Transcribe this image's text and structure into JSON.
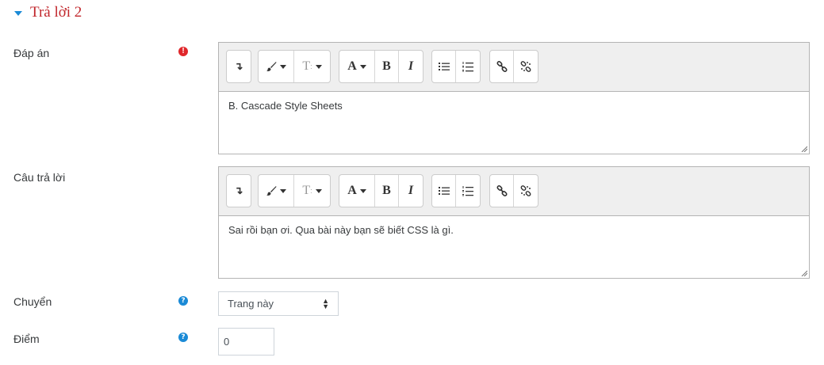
{
  "section": {
    "title": "Trả lời 2"
  },
  "fields": {
    "answer": {
      "label": "Đáp án",
      "value": "B. Cascade Style Sheets"
    },
    "feedback": {
      "label": "Câu trả lời",
      "value": "Sai rồi bạn ơi. Qua bài này bạn sẽ biết CSS là gì."
    },
    "jump": {
      "label": "Chuyển",
      "selected": "Trang này"
    },
    "score": {
      "label": "Điểm",
      "value": "0"
    }
  },
  "icons": {
    "required": "!",
    "help": "?",
    "required_color": "#e0272b",
    "help_color": "#1a8ad6",
    "accent": "#c1262b"
  },
  "toolbar": {
    "show_more": "↴",
    "bold": "B",
    "italic": "I",
    "font_color": "A",
    "font_size": "T"
  }
}
